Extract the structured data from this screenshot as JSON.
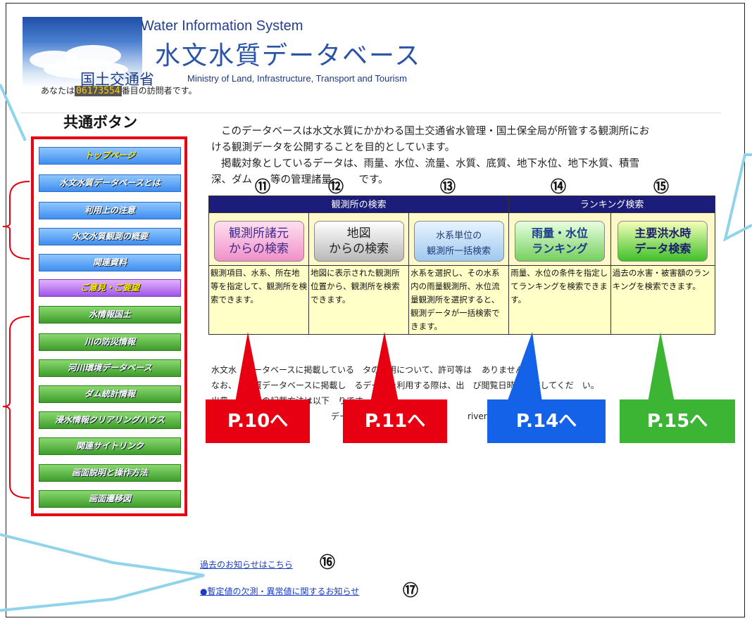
{
  "header": {
    "system_title": "Water Information System",
    "db_title": "水文水質データベース",
    "ministry_jp": "国土交通省",
    "ministry_en": "Ministry of Land, Infrastructure, Transport and Tourism",
    "visitor_prefix": "あなたは",
    "visitor_count": "06173554",
    "visitor_suffix": "番目の訪問者です。"
  },
  "sidebar": {
    "label": "共通ボタン",
    "buttons": [
      "トップページ",
      "水文水質データベースとは",
      "利用上の注意",
      "水文水質観測の概要",
      "関連資料",
      "ご意見・ご要望",
      "水情報国土",
      "川の防災情報",
      "河川環境データベース",
      "ダム統計情報",
      "浸水情報クリアリングハウス",
      "関連サイトリンク",
      "画面説明と操作方法",
      "画面遷移図"
    ]
  },
  "intro": {
    "line1": "このデータベースは水文水質にかかわる国土交通省水管理・国土保全局が所管する観測所にお",
    "line2": "ける観測データを公開することを目的としています。",
    "line3": "掲載対象としているデータは、雨量、水位、流量、水質、底質、地下水位、地下水質、積雪",
    "line4a": "深、ダム",
    "line4b": "等の管理諸量、",
    "line4c": "です。"
  },
  "search": {
    "group1": "観測所の検索",
    "group2": "ランキング検索",
    "buttons": [
      {
        "line1": "観測所諸元",
        "line2": "からの検索"
      },
      {
        "line1": "地図",
        "line2": "からの検索"
      },
      {
        "line1": "水系単位の",
        "line2": "観測所一括検索"
      },
      {
        "line1": "雨量・水位",
        "line2": "ランキング"
      },
      {
        "line1": "主要洪水時",
        "line2": "データ検索"
      }
    ],
    "descriptions": [
      "観測項目、水系、所在地等を指定して、観測所を検索できます。",
      "地図に表示された観測所位置から、観測所を検索できます。",
      "水系を選択し、その水系内の雨量観測所、水位流量観測所を選択すると、観測データが一括検索できます。",
      "雨量、水位の条件を指定してランキングを検索できます。",
      "過去の水害・被害額のランキングを検索できます。"
    ],
    "numbers": [
      "⑪",
      "⑫",
      "⑬",
      "⑭",
      "⑮"
    ]
  },
  "notice": {
    "line1a": "水文水",
    "line1b": "データベースに掲載している",
    "line1c": "タの利用について、許可等は",
    "line1d": "ありません。",
    "line2a": "なお、",
    "line2b": "水質データベースに掲載し",
    "line2c": "るデータを利用する際は、出",
    "line2d": "び閲覧日時を記載してくだ",
    "line2e": "い。",
    "line3a": "出典",
    "line3b": "覧日時の記載方法は以下",
    "line3c": "りです",
    "line4a": "デー",
    "line4b": "river.g"
  },
  "page_refs": [
    "P.10へ",
    "P.11へ",
    "P.14へ",
    "P.15へ"
  ],
  "links": {
    "past_notice": "過去のお知らせはこちら",
    "past_notice_num": "⑯",
    "provisional_notice": "●暫定値の欠測・異常値に関するお知らせ",
    "provisional_notice_num": "⑰"
  },
  "colors": {
    "red_box": "#e60012",
    "ref_red": "#e60012",
    "ref_blue": "#1462e8",
    "ref_green": "#3cb534",
    "callout": "#7fd0e8"
  }
}
